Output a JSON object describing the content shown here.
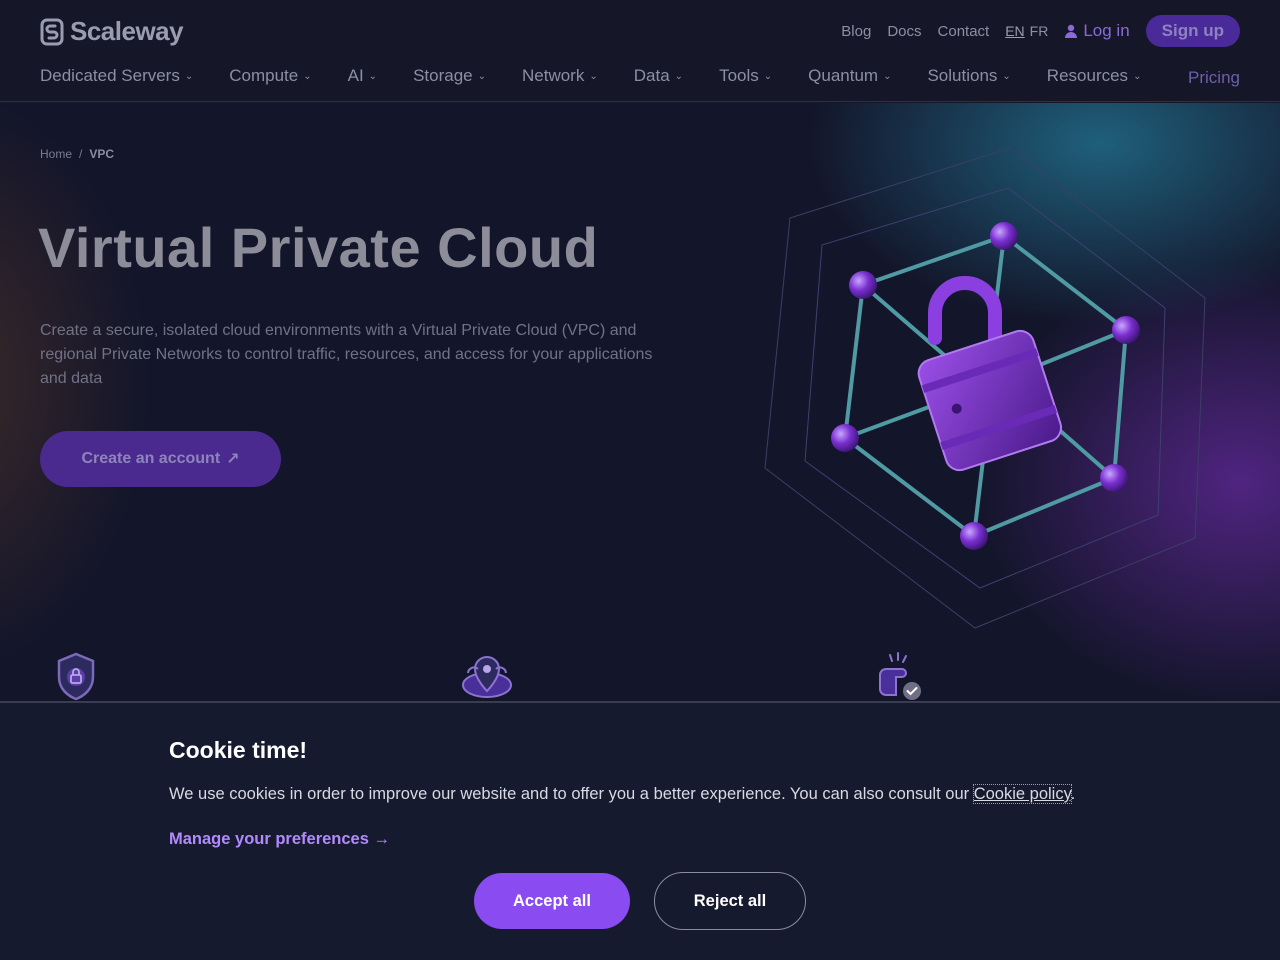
{
  "header": {
    "logo_text": "Scaleway",
    "top_links": [
      "Blog",
      "Docs",
      "Contact"
    ],
    "lang_en": "EN",
    "lang_fr": "FR",
    "login": "Log in",
    "signup": "Sign up",
    "nav": [
      "Dedicated Servers",
      "Compute",
      "AI",
      "Storage",
      "Network",
      "Data",
      "Tools",
      "Quantum",
      "Solutions",
      "Resources"
    ],
    "pricing": "Pricing"
  },
  "breadcrumb": {
    "home": "Home",
    "separator": "/",
    "current": "VPC"
  },
  "hero": {
    "title": "Virtual Private Cloud",
    "description": "Create a secure, isolated cloud environments with a Virtual Private Cloud (VPC) and regional Private Networks to control traffic, resources, and access for your applications and data",
    "cta": "Create an account",
    "cta_icon": "arrow-up-right-icon",
    "illustration_icon": "lock-network-icon"
  },
  "features": {
    "icons": [
      "shield-lock-icon",
      "map-pin-icon",
      "hand-check-icon"
    ]
  },
  "cookie": {
    "title": "Cookie time!",
    "text": "We use cookies in order to improve our website and to offer you a better experience. You can also consult our",
    "policy_link": "Cookie policy",
    "period": ".",
    "manage": "Manage your preferences →",
    "accept": "Accept all",
    "reject": "Reject all"
  },
  "colors": {
    "background": "#151729",
    "accent": "#8a4cf0",
    "link": "#b28aff"
  }
}
